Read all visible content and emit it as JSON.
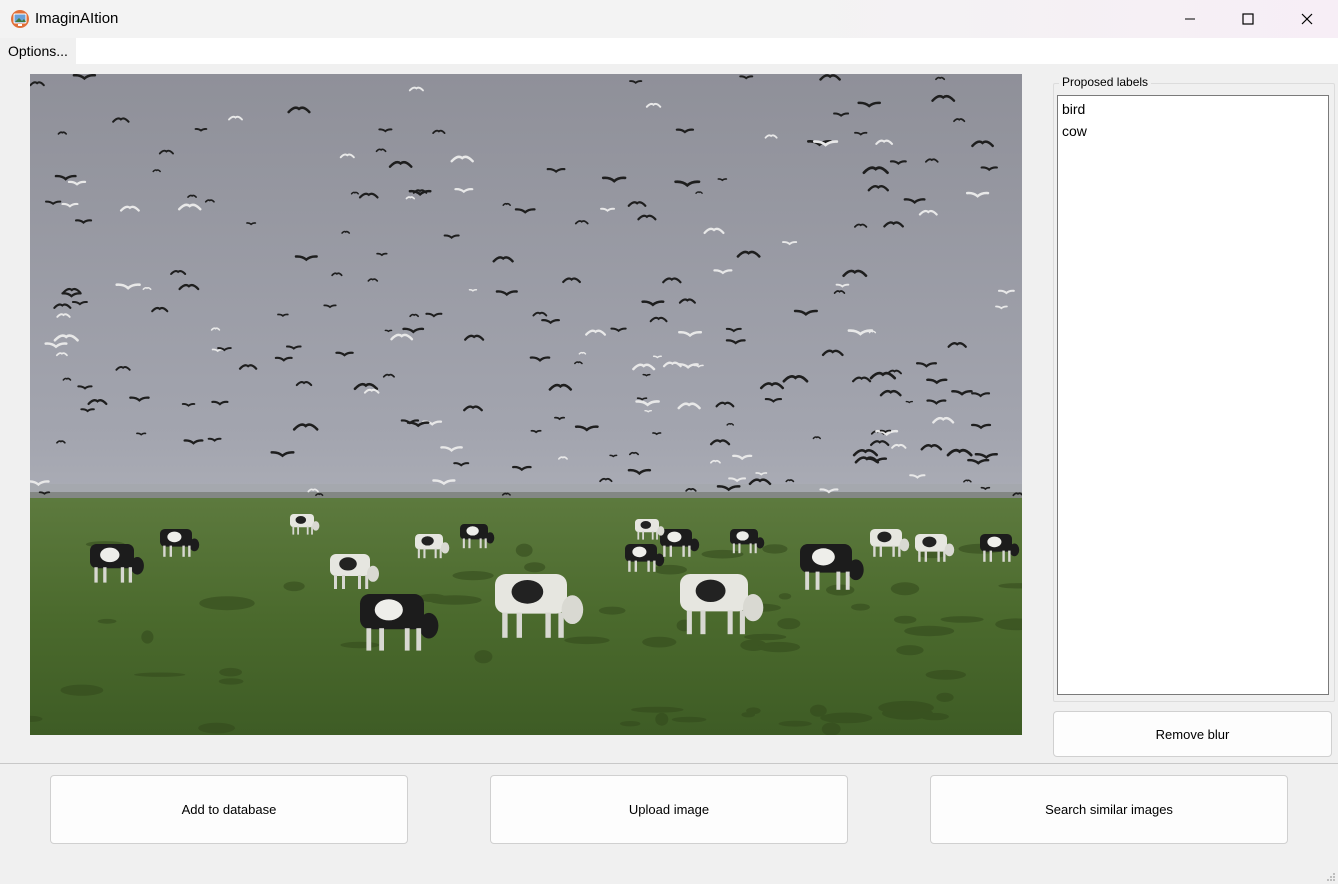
{
  "window": {
    "title": "ImaginAItion"
  },
  "menu": {
    "options_label": "Options..."
  },
  "labels_panel": {
    "title": "Proposed labels",
    "items": [
      "bird",
      "cow"
    ]
  },
  "buttons": {
    "remove_blur": "Remove blur",
    "add_to_database": "Add to database",
    "upload_image": "Upload image",
    "search_similar": "Search similar images"
  },
  "icons": [
    "app-icon",
    "minimize-icon",
    "maximize-icon",
    "close-icon",
    "resize-grip-icon"
  ],
  "colors": {
    "window_bg": "#f0f0f0",
    "button_bg": "#fdfdfd",
    "list_bg": "#ffffff"
  }
}
